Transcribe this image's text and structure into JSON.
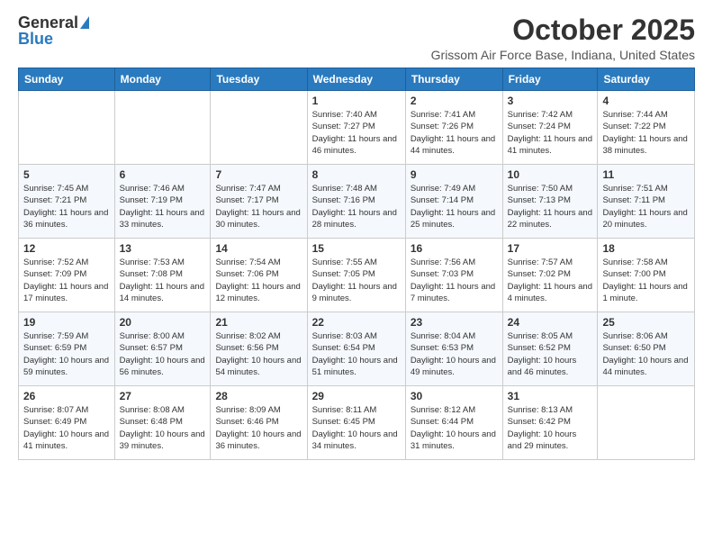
{
  "logo": {
    "general": "General",
    "blue": "Blue"
  },
  "title": "October 2025",
  "location": "Grissom Air Force Base, Indiana, United States",
  "days_of_week": [
    "Sunday",
    "Monday",
    "Tuesday",
    "Wednesday",
    "Thursday",
    "Friday",
    "Saturday"
  ],
  "weeks": [
    [
      {
        "day": "",
        "info": ""
      },
      {
        "day": "",
        "info": ""
      },
      {
        "day": "",
        "info": ""
      },
      {
        "day": "1",
        "info": "Sunrise: 7:40 AM\nSunset: 7:27 PM\nDaylight: 11 hours and 46 minutes."
      },
      {
        "day": "2",
        "info": "Sunrise: 7:41 AM\nSunset: 7:26 PM\nDaylight: 11 hours and 44 minutes."
      },
      {
        "day": "3",
        "info": "Sunrise: 7:42 AM\nSunset: 7:24 PM\nDaylight: 11 hours and 41 minutes."
      },
      {
        "day": "4",
        "info": "Sunrise: 7:44 AM\nSunset: 7:22 PM\nDaylight: 11 hours and 38 minutes."
      }
    ],
    [
      {
        "day": "5",
        "info": "Sunrise: 7:45 AM\nSunset: 7:21 PM\nDaylight: 11 hours and 36 minutes."
      },
      {
        "day": "6",
        "info": "Sunrise: 7:46 AM\nSunset: 7:19 PM\nDaylight: 11 hours and 33 minutes."
      },
      {
        "day": "7",
        "info": "Sunrise: 7:47 AM\nSunset: 7:17 PM\nDaylight: 11 hours and 30 minutes."
      },
      {
        "day": "8",
        "info": "Sunrise: 7:48 AM\nSunset: 7:16 PM\nDaylight: 11 hours and 28 minutes."
      },
      {
        "day": "9",
        "info": "Sunrise: 7:49 AM\nSunset: 7:14 PM\nDaylight: 11 hours and 25 minutes."
      },
      {
        "day": "10",
        "info": "Sunrise: 7:50 AM\nSunset: 7:13 PM\nDaylight: 11 hours and 22 minutes."
      },
      {
        "day": "11",
        "info": "Sunrise: 7:51 AM\nSunset: 7:11 PM\nDaylight: 11 hours and 20 minutes."
      }
    ],
    [
      {
        "day": "12",
        "info": "Sunrise: 7:52 AM\nSunset: 7:09 PM\nDaylight: 11 hours and 17 minutes."
      },
      {
        "day": "13",
        "info": "Sunrise: 7:53 AM\nSunset: 7:08 PM\nDaylight: 11 hours and 14 minutes."
      },
      {
        "day": "14",
        "info": "Sunrise: 7:54 AM\nSunset: 7:06 PM\nDaylight: 11 hours and 12 minutes."
      },
      {
        "day": "15",
        "info": "Sunrise: 7:55 AM\nSunset: 7:05 PM\nDaylight: 11 hours and 9 minutes."
      },
      {
        "day": "16",
        "info": "Sunrise: 7:56 AM\nSunset: 7:03 PM\nDaylight: 11 hours and 7 minutes."
      },
      {
        "day": "17",
        "info": "Sunrise: 7:57 AM\nSunset: 7:02 PM\nDaylight: 11 hours and 4 minutes."
      },
      {
        "day": "18",
        "info": "Sunrise: 7:58 AM\nSunset: 7:00 PM\nDaylight: 11 hours and 1 minute."
      }
    ],
    [
      {
        "day": "19",
        "info": "Sunrise: 7:59 AM\nSunset: 6:59 PM\nDaylight: 10 hours and 59 minutes."
      },
      {
        "day": "20",
        "info": "Sunrise: 8:00 AM\nSunset: 6:57 PM\nDaylight: 10 hours and 56 minutes."
      },
      {
        "day": "21",
        "info": "Sunrise: 8:02 AM\nSunset: 6:56 PM\nDaylight: 10 hours and 54 minutes."
      },
      {
        "day": "22",
        "info": "Sunrise: 8:03 AM\nSunset: 6:54 PM\nDaylight: 10 hours and 51 minutes."
      },
      {
        "day": "23",
        "info": "Sunrise: 8:04 AM\nSunset: 6:53 PM\nDaylight: 10 hours and 49 minutes."
      },
      {
        "day": "24",
        "info": "Sunrise: 8:05 AM\nSunset: 6:52 PM\nDaylight: 10 hours and 46 minutes."
      },
      {
        "day": "25",
        "info": "Sunrise: 8:06 AM\nSunset: 6:50 PM\nDaylight: 10 hours and 44 minutes."
      }
    ],
    [
      {
        "day": "26",
        "info": "Sunrise: 8:07 AM\nSunset: 6:49 PM\nDaylight: 10 hours and 41 minutes."
      },
      {
        "day": "27",
        "info": "Sunrise: 8:08 AM\nSunset: 6:48 PM\nDaylight: 10 hours and 39 minutes."
      },
      {
        "day": "28",
        "info": "Sunrise: 8:09 AM\nSunset: 6:46 PM\nDaylight: 10 hours and 36 minutes."
      },
      {
        "day": "29",
        "info": "Sunrise: 8:11 AM\nSunset: 6:45 PM\nDaylight: 10 hours and 34 minutes."
      },
      {
        "day": "30",
        "info": "Sunrise: 8:12 AM\nSunset: 6:44 PM\nDaylight: 10 hours and 31 minutes."
      },
      {
        "day": "31",
        "info": "Sunrise: 8:13 AM\nSunset: 6:42 PM\nDaylight: 10 hours and 29 minutes."
      },
      {
        "day": "",
        "info": ""
      }
    ]
  ]
}
